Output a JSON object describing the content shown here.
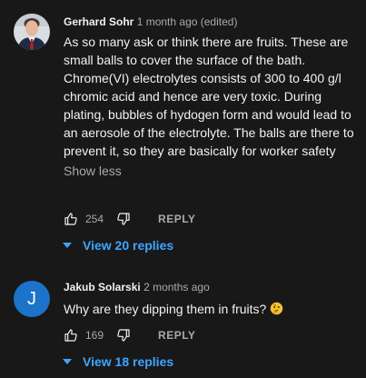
{
  "comments": [
    {
      "author": "Gerhard Sohr",
      "time": "1 month ago (edited)",
      "text": "As so many ask or think there are fruits. These are small balls to cover the surface of the bath. Chrome(VI) electrolytes consists of 300 to 400 g/l chromic acid and hence are very toxic. During plating, bubbles of hydogen form and would lead to an aerosole of the electrolyte. The balls are there to prevent it, so they are basically for worker safety",
      "show_less": "Show less",
      "likes": "254",
      "reply_label": "REPLY",
      "view_replies": "View 20 replies"
    },
    {
      "author": "Jakub Solarski",
      "avatar_letter": "J",
      "time": "2 months ago",
      "text": "Why are they dipping them in fruits?",
      "likes": "169",
      "reply_label": "REPLY",
      "view_replies": "View 18 replies"
    }
  ],
  "colors": {
    "background": "#181818",
    "link": "#3ea6ff",
    "avatar_j": "#1c73c9",
    "secondary_text": "#aaaaaa"
  },
  "icons": [
    "avatar-photo",
    "thumbs-up-icon",
    "thumbs-down-icon",
    "caret-down-icon",
    "thinking-face-emoji"
  ]
}
